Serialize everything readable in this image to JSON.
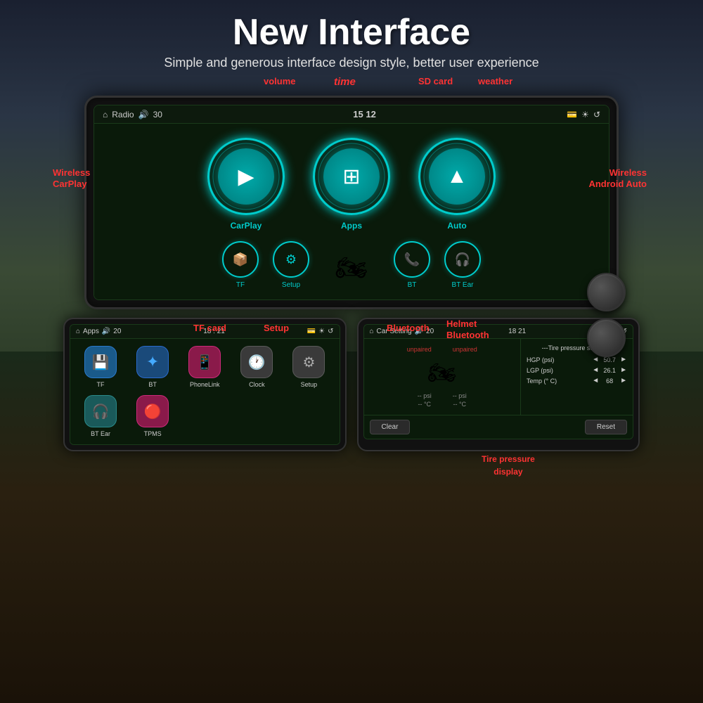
{
  "header": {
    "title": "New Interface",
    "subtitle": "Simple and generous interface design style, better user experience"
  },
  "annotations": {
    "volume": "volume",
    "time": "time",
    "sd_card": "SD card",
    "weather": "weather",
    "wireless_carplay": "Wireless\nCarPlay",
    "wireless_android": "Wireless\nAndroid Auto",
    "tf_card": "TF card",
    "setup": "Setup",
    "bluetooth": "Bluetooth",
    "helmet_bluetooth": "Helmet\nBluetooth",
    "tire_pressure": "Tire pressure\ndisplay"
  },
  "main_screen": {
    "topbar": {
      "home_icon": "⌂",
      "label": "Radio",
      "volume_icon": "🔊",
      "volume": "30",
      "time": "15 12",
      "sd_icon": "💳",
      "brightness_icon": "☀",
      "back_icon": "↺"
    },
    "big_buttons": [
      {
        "label": "CarPlay",
        "icon": "▶"
      },
      {
        "label": "Apps",
        "icon": "⊞"
      },
      {
        "label": "Auto",
        "icon": "▲"
      }
    ],
    "small_buttons": [
      {
        "label": "TF",
        "icon": "📦"
      },
      {
        "label": "Setup",
        "icon": "⚙"
      },
      {
        "label": "",
        "icon": "🏍"
      },
      {
        "label": "BT",
        "icon": "📞"
      },
      {
        "label": "BT Ear",
        "icon": "🎧"
      }
    ]
  },
  "apps_screen": {
    "topbar": {
      "home_icon": "⌂",
      "label": "Apps",
      "volume_icon": "🔊",
      "volume": "20",
      "time": "18 : 21",
      "sd_icon": "💳",
      "brightness_icon": "☀",
      "back_icon": "↺"
    },
    "apps": [
      {
        "label": "TF",
        "icon": "💾",
        "color": "blue"
      },
      {
        "label": "BT",
        "icon": "✦",
        "color": "blue2"
      },
      {
        "label": "PhoneLink",
        "icon": "📱",
        "color": "pink"
      },
      {
        "label": "Clock",
        "icon": "🕐",
        "color": "gray"
      },
      {
        "label": "Setup",
        "icon": "⚙",
        "color": "gray"
      }
    ],
    "apps_row2": [
      {
        "label": "BT Ear",
        "icon": "🎧",
        "color": "teal"
      },
      {
        "label": "TPMS",
        "icon": "🔴",
        "color": "pink"
      }
    ]
  },
  "car_setting_screen": {
    "topbar": {
      "home_icon": "⌂",
      "label": "Car Setting",
      "volume_icon": "🔊",
      "volume": "20",
      "time": "18 21",
      "sd_icon": "💳",
      "brightness_icon": "☀",
      "back_icon": "↺"
    },
    "sensors": {
      "front": {
        "status": "unpaired",
        "psi": "-- psi",
        "temp": "-- °C"
      },
      "rear": {
        "status": "unpaired",
        "psi": "-- psi",
        "temp": "-- °C"
      }
    },
    "pressure_settings": {
      "title": "---Tire pressure setting---",
      "hgp_label": "HGP (psi)",
      "hgp_val": "50.7",
      "lgp_label": "LGP (psi)",
      "lgp_val": "26.1",
      "temp_label": "Temp (° C)",
      "temp_val": "68"
    },
    "buttons": {
      "clear": "Clear",
      "reset": "Reset"
    }
  }
}
